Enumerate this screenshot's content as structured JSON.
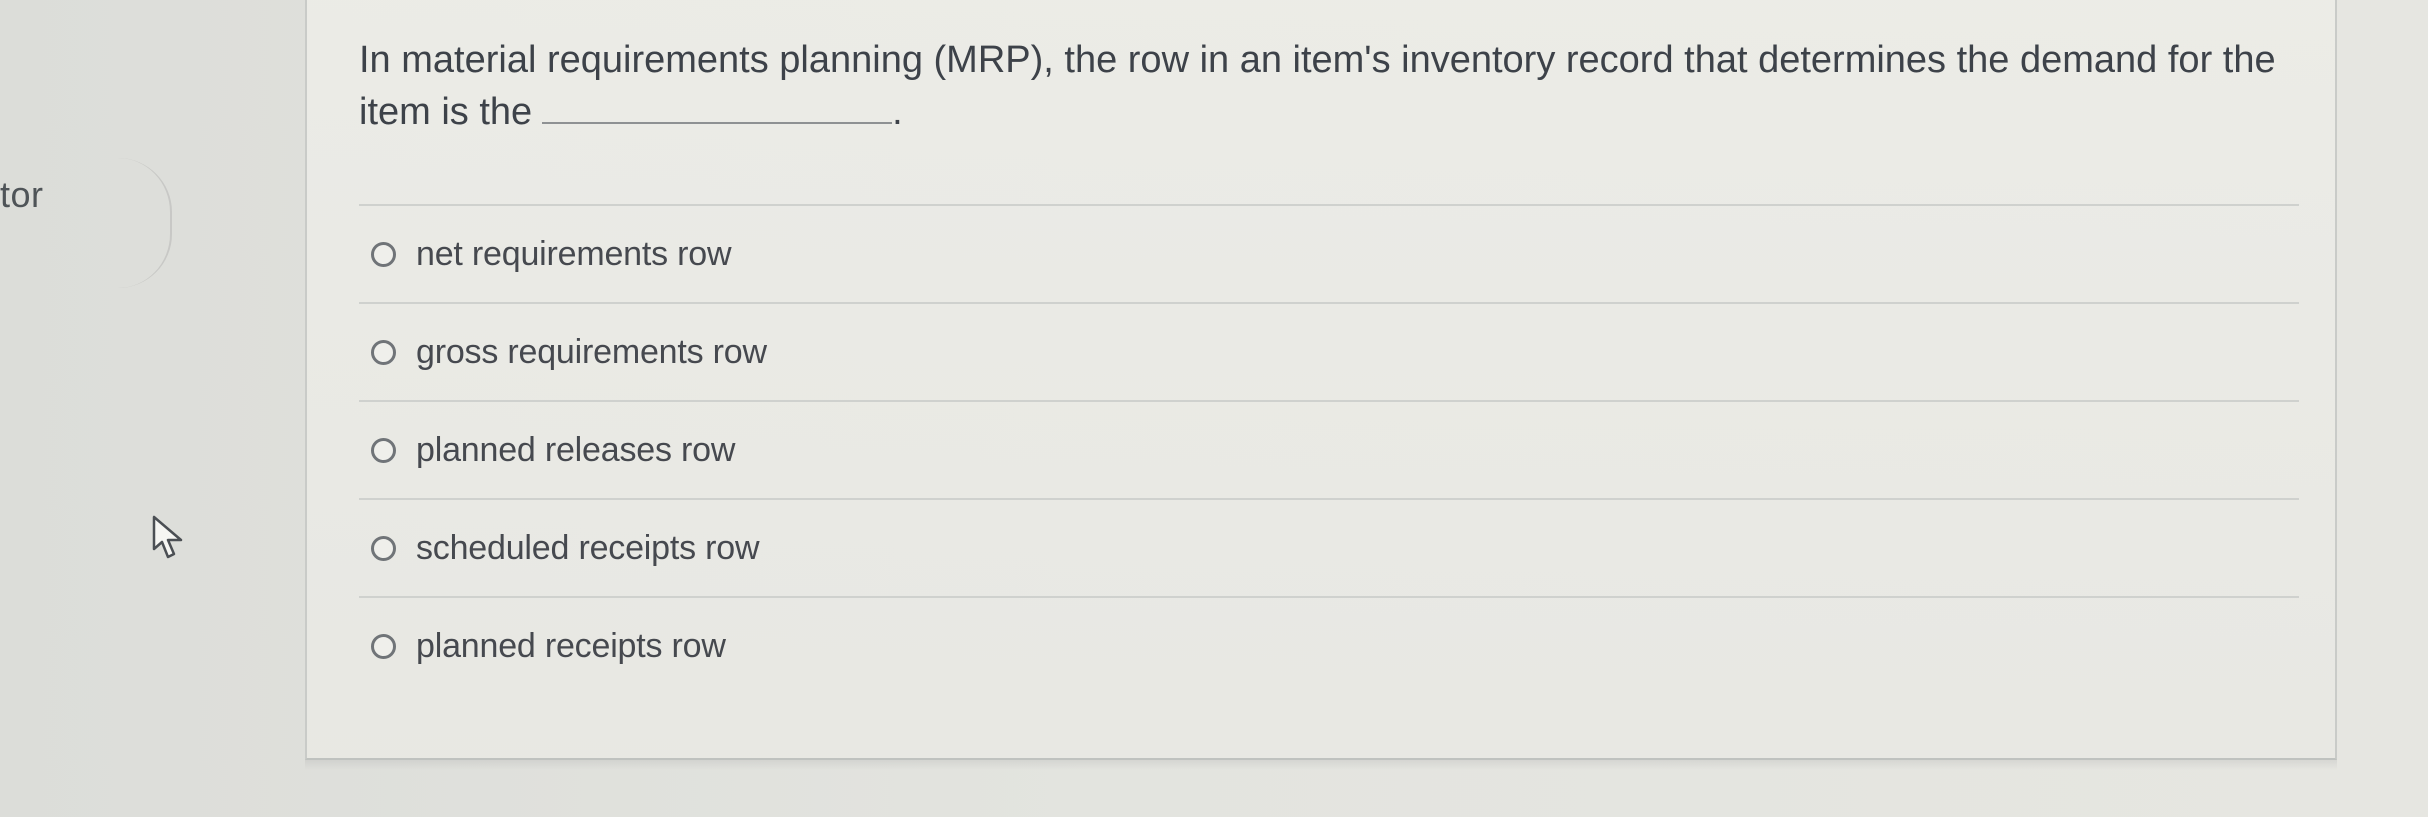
{
  "left_panel": {
    "truncated_text": "tor"
  },
  "question": {
    "prompt": "In material requirements planning (MRP), the row in an item's inventory record that determines the demand for the item is the",
    "blank_suffix": "."
  },
  "options": [
    {
      "label": "net requirements row"
    },
    {
      "label": "gross requirements row"
    },
    {
      "label": "planned releases row"
    },
    {
      "label": "scheduled receipts row"
    },
    {
      "label": "planned receipts row"
    }
  ],
  "icons": {
    "cursor": "cursor-arrow-icon",
    "radio": "radio-button-icon"
  },
  "colors": {
    "background": "#e3e4df",
    "text": "#3d4249",
    "divider": "#cfd1ce"
  }
}
